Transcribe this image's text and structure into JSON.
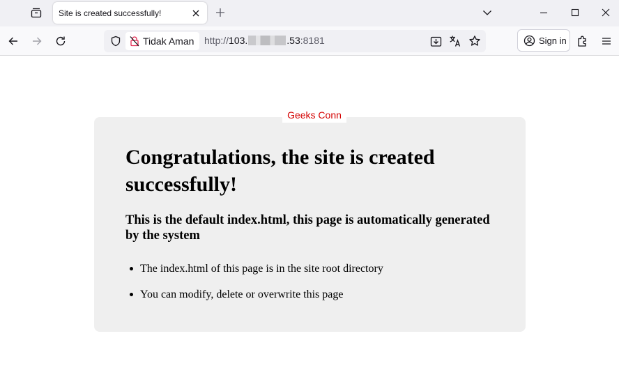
{
  "browser": {
    "tab_title": "Site is created successfully!",
    "security_label": "Tidak Aman",
    "url": {
      "scheme": "http://",
      "host_start": "103.",
      "host_end": ".53",
      "port": ":8181"
    },
    "signin_label": "Sign in"
  },
  "page": {
    "watermark": "Geeks Conn",
    "heading": "Congratulations, the site is created successfully!",
    "subheading": "This is the default index.html, this page is automatically generated by the system",
    "items": [
      "The index.html of this page is in the site root directory",
      "You can modify, delete or overwrite this page"
    ]
  },
  "colors": {
    "tabstrip_bg": "#f0f0f4",
    "card_bg": "#efefef",
    "watermark_text": "#d40000",
    "insecure_icon": "#e22850"
  },
  "icons": [
    "tab-list-icon",
    "close-icon",
    "plus-icon",
    "chevron-down-icon",
    "minimize-icon",
    "maximize-icon",
    "window-close-icon",
    "back-arrow-icon",
    "forward-arrow-icon",
    "reload-icon",
    "shield-icon",
    "insecure-lock-icon",
    "download-icon",
    "translate-icon",
    "star-icon",
    "account-icon",
    "extensions-icon",
    "menu-icon"
  ]
}
